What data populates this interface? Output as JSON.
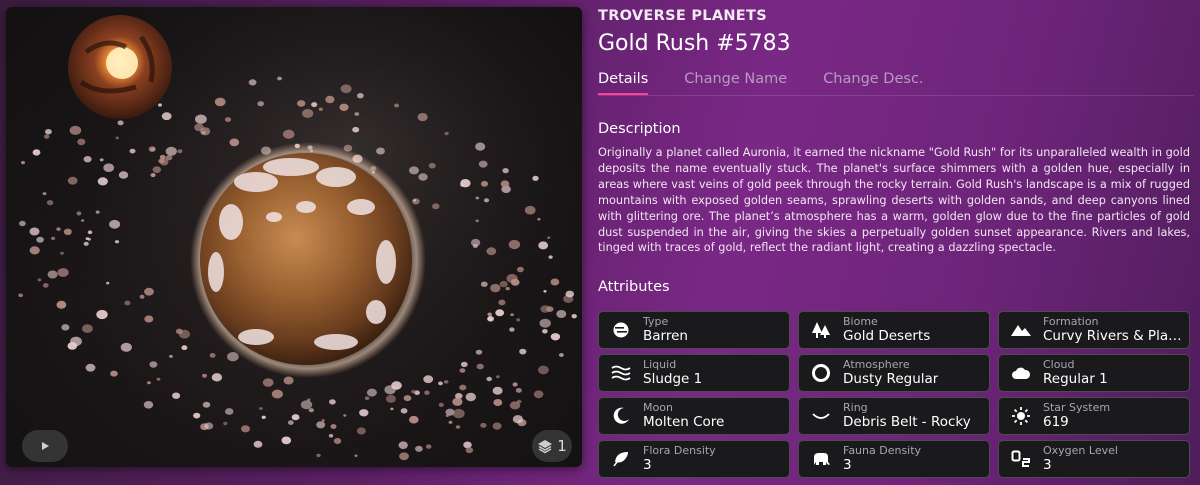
{
  "media": {
    "layers_count": "1",
    "icons": {
      "play": "play-icon",
      "layers": "layers-icon"
    }
  },
  "header": {
    "collection": "TROVERSE PLANETS",
    "title": "Gold Rush #5783"
  },
  "tabs": [
    {
      "label": "Details",
      "active": true
    },
    {
      "label": "Change Name",
      "active": false
    },
    {
      "label": "Change Desc.",
      "active": false
    }
  ],
  "description": {
    "heading": "Description",
    "text": "Originally a planet called Auronia, it earned the nickname \"Gold Rush\" for its unparalleled wealth in gold deposits the name eventually stuck. The planet's surface shimmers with a golden hue, especially in areas where vast veins of gold peek through the rocky terrain. Gold Rush's landscape is a mix of rugged mountains with exposed golden seams, sprawling deserts with golden sands, and deep canyons lined with glittering ore. The planet’s atmosphere has a warm, golden glow due to the fine particles of gold dust suspended in the air, giving the skies a perpetually golden sunset appearance. Rivers and lakes, tinged with traces of gold, reflect the radiant light, creating a dazzling spectacle."
  },
  "attributes": {
    "heading": "Attributes",
    "items": [
      {
        "label": "Type",
        "value": "Barren",
        "icon": "planet-type-icon"
      },
      {
        "label": "Biome",
        "value": "Gold Deserts",
        "icon": "trees-icon"
      },
      {
        "label": "Formation",
        "value": "Curvy Rivers & Plat…",
        "icon": "mountains-icon"
      },
      {
        "label": "Liquid",
        "value": "Sludge 1",
        "icon": "waves-icon"
      },
      {
        "label": "Atmosphere",
        "value": "Dusty Regular",
        "icon": "atmosphere-ring-icon"
      },
      {
        "label": "Cloud",
        "value": "Regular 1",
        "icon": "cloud-icon"
      },
      {
        "label": "Moon",
        "value": "Molten Core",
        "icon": "moon-icon"
      },
      {
        "label": "Ring",
        "value": "Debris Belt - Rocky",
        "icon": "ring-icon"
      },
      {
        "label": "Star System",
        "value": "619",
        "icon": "sun-icon"
      },
      {
        "label": "Flora Density",
        "value": "3",
        "icon": "leaf-icon"
      },
      {
        "label": "Fauna Density",
        "value": "3",
        "icon": "elephant-icon"
      },
      {
        "label": "Oxygen Level",
        "value": "3",
        "icon": "o2-icon"
      }
    ]
  },
  "colors": {
    "accent": "#ff3f9b",
    "card_bg": "#1a1a1d",
    "bg_purple": "#7a2886"
  }
}
